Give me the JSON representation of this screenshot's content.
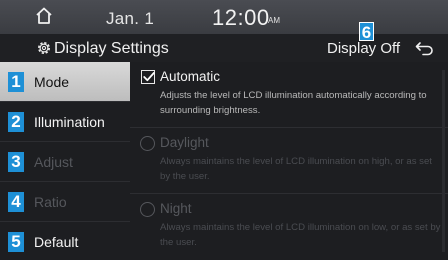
{
  "status": {
    "date": "Jan.  1",
    "time": "12:00",
    "ampm": "AM"
  },
  "titlebar": {
    "title": "Display Settings",
    "display_off_label": "Display Off",
    "display_off_badge": "6"
  },
  "sidebar": {
    "items": [
      {
        "badge": "1",
        "label": "Mode",
        "state": "active"
      },
      {
        "badge": "2",
        "label": "Illumination",
        "state": "enabled"
      },
      {
        "badge": "3",
        "label": "Adjust",
        "state": "disabled"
      },
      {
        "badge": "4",
        "label": "Ratio",
        "state": "disabled"
      },
      {
        "badge": "5",
        "label": "Default",
        "state": "enabled"
      }
    ]
  },
  "options": [
    {
      "title": "Automatic",
      "desc": "Adjusts the level of LCD illumination automatically according to surrounding brightness.",
      "control": "checkbox",
      "checked": true,
      "enabled": true
    },
    {
      "title": "Daylight",
      "desc": "Always maintains the level of LCD illumination on high, or as set by the user.",
      "control": "radio",
      "checked": false,
      "enabled": false
    },
    {
      "title": "Night",
      "desc": "Always maintains the level of LCD illumination on low, or as set by the user.",
      "control": "radio",
      "checked": false,
      "enabled": false
    }
  ],
  "colors": {
    "badge": "#1e90d6",
    "active_tab": "#d0d0d0",
    "background": "#1d1e21"
  },
  "icons": {
    "home": "home-icon",
    "settings": "gear-icon",
    "back": "back-arrow-icon",
    "check": "check-icon"
  }
}
